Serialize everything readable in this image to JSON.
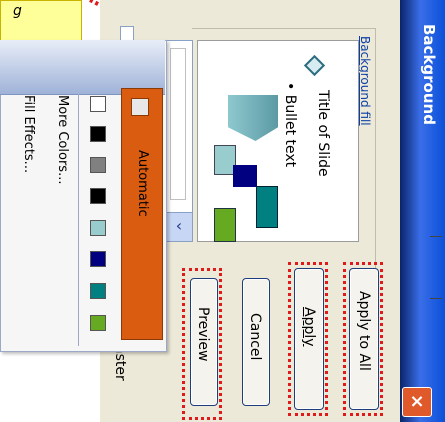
{
  "dialog": {
    "title": "Background",
    "close_label": "×",
    "group_label": "Background fill",
    "preview": {
      "title_text": "Title of Slide",
      "bullet_text": "• Bullet text"
    },
    "combo_arrow": "‹",
    "master_label": "aster"
  },
  "buttons": {
    "apply_to_all": "Apply to All",
    "apply": "Apply",
    "cancel": "Cancel",
    "preview": "Preview"
  },
  "color_menu": {
    "automatic_label": "Automatic",
    "more_colors": "More Colors...",
    "fill_effects": "Fill Effects...",
    "swatches_column1": [
      "#ffffff",
      "#000000",
      "#808080",
      "#000000",
      "#99cccc",
      "#000080",
      "#008080",
      "#66aa22"
    ],
    "automatic_swatch": "#e8e8e8",
    "accent_color": "#d95c10"
  },
  "colors": {
    "title_bar": "#0a50d8",
    "highlight": "#e0191a",
    "chart_bars": [
      "#99cccc",
      "#000080",
      "#008080",
      "#66aa22"
    ]
  }
}
